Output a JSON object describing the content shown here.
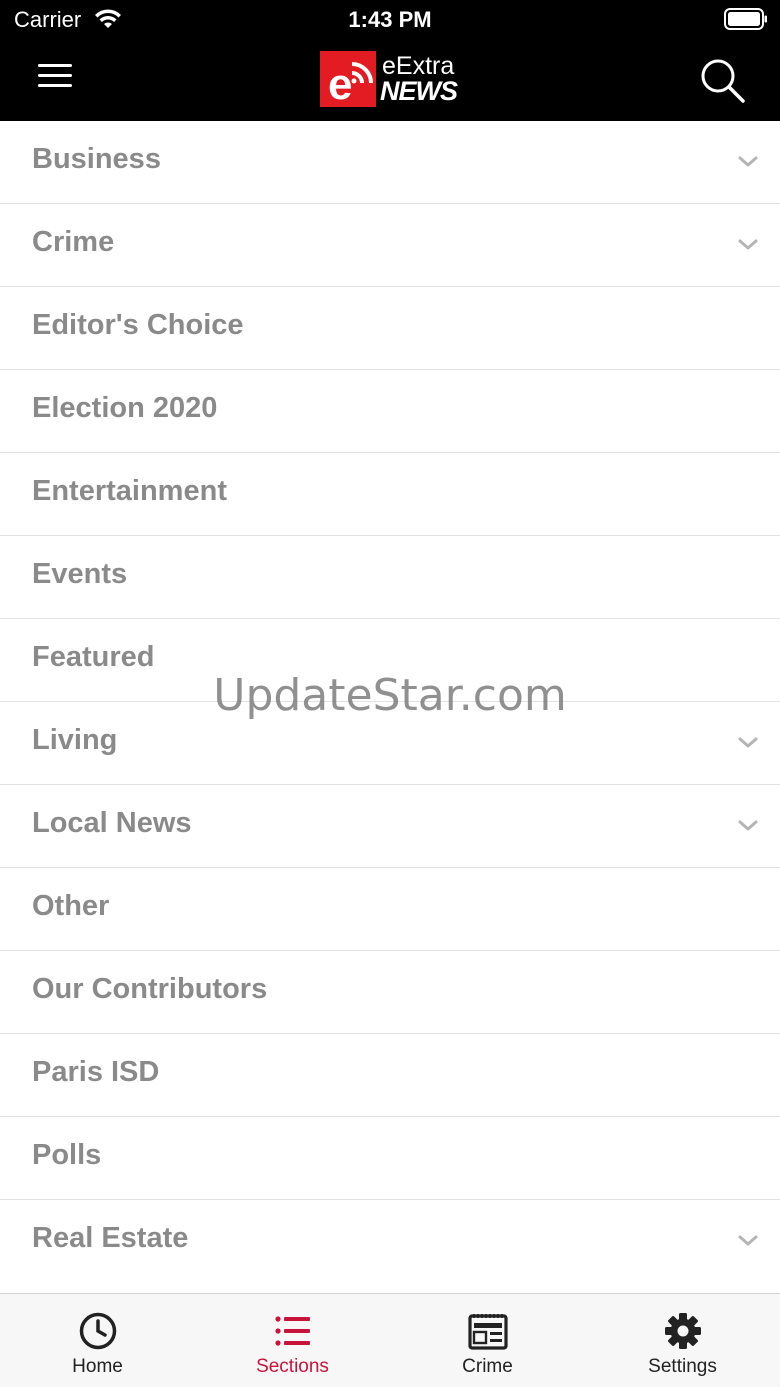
{
  "status_bar": {
    "carrier": "Carrier",
    "time": "1:43 PM"
  },
  "header": {
    "logo_line1": "eExtra",
    "logo_line2": "NEWS",
    "menu_icon": "hamburger-menu-icon",
    "search_icon": "search-icon"
  },
  "sections": [
    {
      "label": "Business",
      "expandable": true
    },
    {
      "label": "Crime",
      "expandable": true
    },
    {
      "label": "Editor's Choice",
      "expandable": false
    },
    {
      "label": "Election 2020",
      "expandable": false
    },
    {
      "label": "Entertainment",
      "expandable": false
    },
    {
      "label": "Events",
      "expandable": false
    },
    {
      "label": "Featured",
      "expandable": false
    },
    {
      "label": "Living",
      "expandable": true
    },
    {
      "label": "Local News",
      "expandable": true
    },
    {
      "label": "Other",
      "expandable": false
    },
    {
      "label": "Our Contributors",
      "expandable": false
    },
    {
      "label": "Paris ISD",
      "expandable": false
    },
    {
      "label": "Polls",
      "expandable": false
    },
    {
      "label": "Real Estate",
      "expandable": true
    }
  ],
  "watermark": "UpdateStar.com",
  "tabs": [
    {
      "label": "Home",
      "icon": "clock-icon",
      "active": false
    },
    {
      "label": "Sections",
      "icon": "list-icon",
      "active": true
    },
    {
      "label": "Crime",
      "icon": "newspaper-icon",
      "active": false
    },
    {
      "label": "Settings",
      "icon": "gear-icon",
      "active": false
    }
  ],
  "colors": {
    "accent": "#c8143c",
    "brand_red": "#e31b23",
    "header_bg": "#000000",
    "section_text": "#8a8a8a"
  }
}
